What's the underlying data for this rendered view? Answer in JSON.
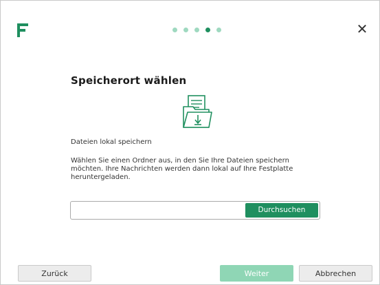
{
  "wizard": {
    "steps_total": 5,
    "step_active": 4
  },
  "header": {
    "close_symbol": "✕",
    "logo_icon": "brand-f-logo-icon",
    "close_icon": "close-icon"
  },
  "content": {
    "title": "Speicherort wählen",
    "icon": "folder-download-icon",
    "subtitle": "Dateien lokal speichern",
    "description": "Wählen Sie einen Ordner aus, in den Sie Ihre Dateien speichern möchten. Ihre Nachrichten werden dann lokal auf Ihre Festplatte heruntergeladen.",
    "path_value": "",
    "path_placeholder": "",
    "browse_label": "Durchsuchen"
  },
  "footer": {
    "back_label": "Zurück",
    "next_label": "Weiter",
    "cancel_label": "Abbrechen"
  },
  "colors": {
    "accent": "#1f8f5f",
    "accent_light": "#8fd6b5",
    "dot_inactive": "#9fd9c0"
  }
}
